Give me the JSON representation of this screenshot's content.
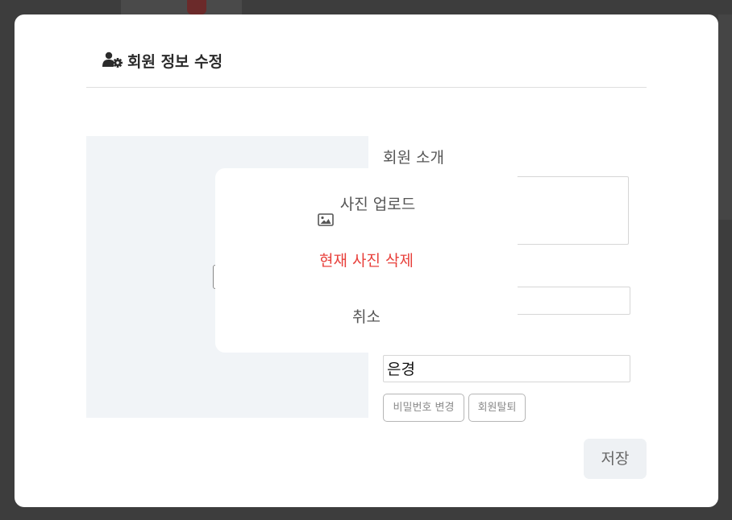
{
  "modal": {
    "title": "회원 정보 수정",
    "title_icon": "user-gear-icon"
  },
  "form": {
    "intro_label": "회원 소개",
    "intro_value": "",
    "field2_value": "",
    "name_value": "은경",
    "password_change_label": "비밀번호 변경",
    "withdraw_label": "회원탈퇴",
    "save_label": "저장"
  },
  "photo_menu": {
    "upload_icon": "image-icon",
    "upload_label": "사진 업로드",
    "delete_label": "현재 사진 삭제",
    "cancel_label": "취소"
  },
  "colors": {
    "danger": "#e8413c",
    "overlay": "#3d3d3d",
    "photo_bg": "#f1f4f7",
    "save_bg": "#eef1f4"
  }
}
